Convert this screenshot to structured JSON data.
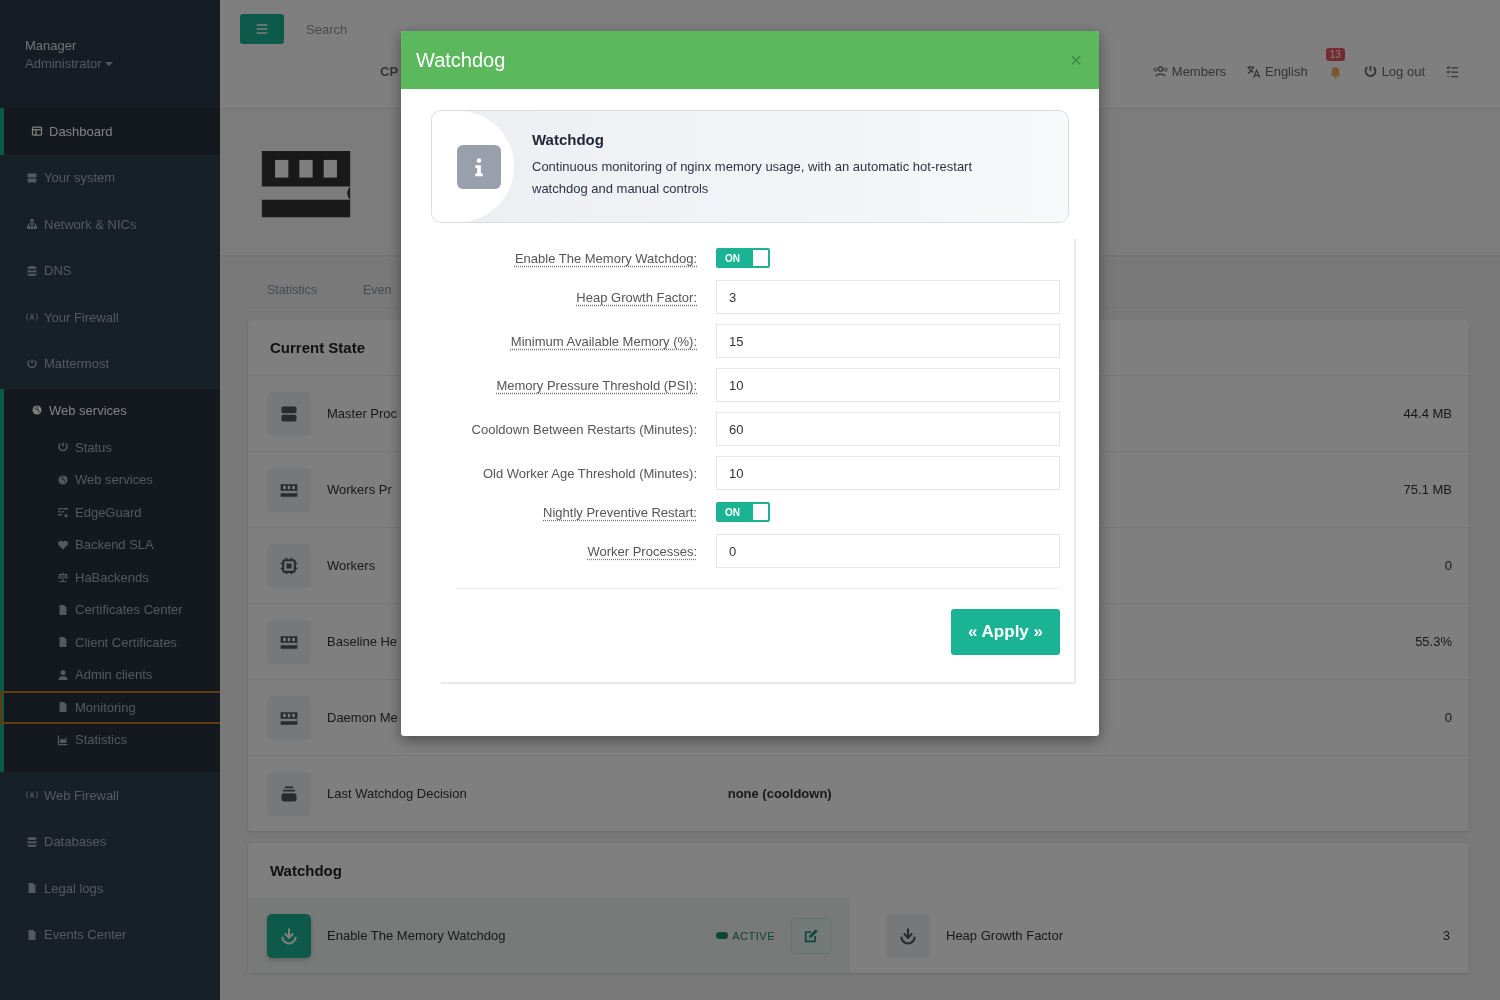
{
  "sidebar": {
    "user": {
      "name": "Manager",
      "role": "Administrator"
    },
    "items": [
      {
        "label": "Dashboard",
        "selected": true
      },
      {
        "label": "Your system",
        "selected": false
      },
      {
        "label": "Network & NICs",
        "selected": false
      },
      {
        "label": "DNS",
        "selected": false
      },
      {
        "label": "Your Firewall",
        "selected": false
      },
      {
        "label": "Mattermost",
        "selected": false
      },
      {
        "label": "Web services",
        "selected": false,
        "expanded": true,
        "children": [
          {
            "label": "Status",
            "focused": false
          },
          {
            "label": "Web services",
            "focused": false
          },
          {
            "label": "EdgeGuard",
            "focused": false
          },
          {
            "label": "Backend SLA",
            "focused": false
          },
          {
            "label": "HaBackends",
            "focused": false
          },
          {
            "label": "Certificates Center",
            "focused": false
          },
          {
            "label": "Client Certificates",
            "focused": false
          },
          {
            "label": "Admin clients",
            "focused": false
          },
          {
            "label": "Monitoring",
            "focused": true
          },
          {
            "label": "Statistics",
            "focused": false
          }
        ]
      },
      {
        "label": "Web Firewall",
        "selected": false
      },
      {
        "label": "Databases",
        "selected": false
      },
      {
        "label": "Legal logs",
        "selected": false
      },
      {
        "label": "Events Center",
        "selected": false
      }
    ]
  },
  "topbar": {
    "search": {
      "placeholder": "Search"
    },
    "nav_cut": "CP",
    "links": [
      {
        "label": "Members"
      },
      {
        "label": "English"
      }
    ],
    "notifications": "13",
    "logout": "Log out"
  },
  "tabs": [
    {
      "label": "Statistics"
    },
    {
      "label": "Even"
    }
  ],
  "current_state": {
    "title": "Current State",
    "rows": [
      {
        "label": "Master Proc",
        "value": "44.4 MB"
      },
      {
        "label": "Workers Pr",
        "value": "75.1 MB"
      },
      {
        "label": "Workers",
        "value": "0"
      },
      {
        "label": "Baseline He",
        "value": "55.3%"
      },
      {
        "label": "Daemon Me",
        "value": "0"
      },
      {
        "label": "Last Watchdog Decision",
        "detail": "none (cooldown)"
      }
    ]
  },
  "watchdog": {
    "title": "Watchdog",
    "items": [
      {
        "label": "Enable The Memory Watchdog",
        "active": true,
        "status": "ACTIVE"
      },
      {
        "label": "Heap Growth Factor",
        "active": false,
        "value": "3"
      }
    ]
  },
  "modal": {
    "title": "Watchdog",
    "close": "×",
    "info": {
      "title": "Watchdog",
      "text": "Continuous monitoring of nginx memory usage, with an automatic hot-restart watchdog and manual controls"
    },
    "fields": [
      {
        "kind": "toggle",
        "label": "Enable The Memory Watchdog:",
        "tooltip": true,
        "on": true,
        "toggle_text": "ON"
      },
      {
        "kind": "input",
        "label": "Heap Growth Factor:",
        "tooltip": true,
        "value": "3"
      },
      {
        "kind": "input",
        "label": "Minimum Available Memory (%):",
        "tooltip": true,
        "value": "15"
      },
      {
        "kind": "input",
        "label": "Memory Pressure Threshold (PSI):",
        "tooltip": true,
        "value": "10"
      },
      {
        "kind": "input",
        "label": "Cooldown Between Restarts (Minutes):",
        "tooltip": false,
        "value": "60"
      },
      {
        "kind": "input",
        "label": "Old Worker Age Threshold (Minutes):",
        "tooltip": false,
        "value": "10"
      },
      {
        "kind": "toggle",
        "label": "Nightly Preventive Restart:",
        "tooltip": true,
        "on": true,
        "toggle_text": "ON"
      },
      {
        "kind": "input",
        "label": "Worker Processes:",
        "tooltip": true,
        "value": "0"
      }
    ],
    "apply": "« Apply »"
  }
}
